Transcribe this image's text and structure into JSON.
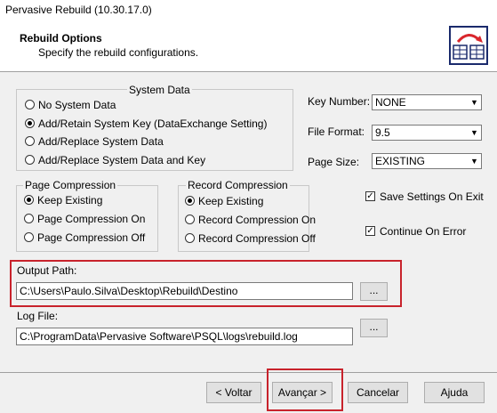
{
  "window": {
    "title": "Pervasive Rebuild (10.30.17.0)"
  },
  "header": {
    "title": "Rebuild Options",
    "subtitle": "Specify the rebuild configurations."
  },
  "system_data": {
    "legend": "System Data",
    "options": [
      {
        "label": "No System Data",
        "checked": false
      },
      {
        "label": "Add/Retain System Key (DataExchange Setting)",
        "checked": true
      },
      {
        "label": "Add/Replace System Data",
        "checked": false
      },
      {
        "label": "Add/Replace System Data and Key",
        "checked": false
      }
    ]
  },
  "key_number": {
    "label": "Key Number:",
    "value": "NONE"
  },
  "file_format": {
    "label": "File Format:",
    "value": "9.5"
  },
  "page_size": {
    "label": "Page Size:",
    "value": "EXISTING"
  },
  "page_compression": {
    "legend": "Page Compression",
    "options": [
      {
        "label": "Keep Existing",
        "checked": true
      },
      {
        "label": "Page Compression On",
        "checked": false
      },
      {
        "label": "Page Compression Off",
        "checked": false
      }
    ]
  },
  "record_compression": {
    "legend": "Record Compression",
    "options": [
      {
        "label": "Keep Existing",
        "checked": true
      },
      {
        "label": "Record Compression On",
        "checked": false
      },
      {
        "label": "Record Compression Off",
        "checked": false
      }
    ]
  },
  "save_settings": {
    "label": "Save Settings On Exit",
    "checked": true
  },
  "continue_on_error": {
    "label": "Continue On Error",
    "checked": true
  },
  "output_path": {
    "label": "Output Path:",
    "value": "C:\\Users\\Paulo.Silva\\Desktop\\Rebuild\\Destino",
    "browse": "..."
  },
  "log_file": {
    "label": "Log File:",
    "value": "C:\\ProgramData\\Pervasive Software\\PSQL\\logs\\rebuild.log",
    "browse": "..."
  },
  "buttons": {
    "back": "< Voltar",
    "next": "Avançar >",
    "cancel": "Cancelar",
    "help": "Ajuda"
  },
  "colors": {
    "highlight": "#c8232c",
    "logo_accent": "#d9262c",
    "logo_border": "#1a2a6c"
  }
}
